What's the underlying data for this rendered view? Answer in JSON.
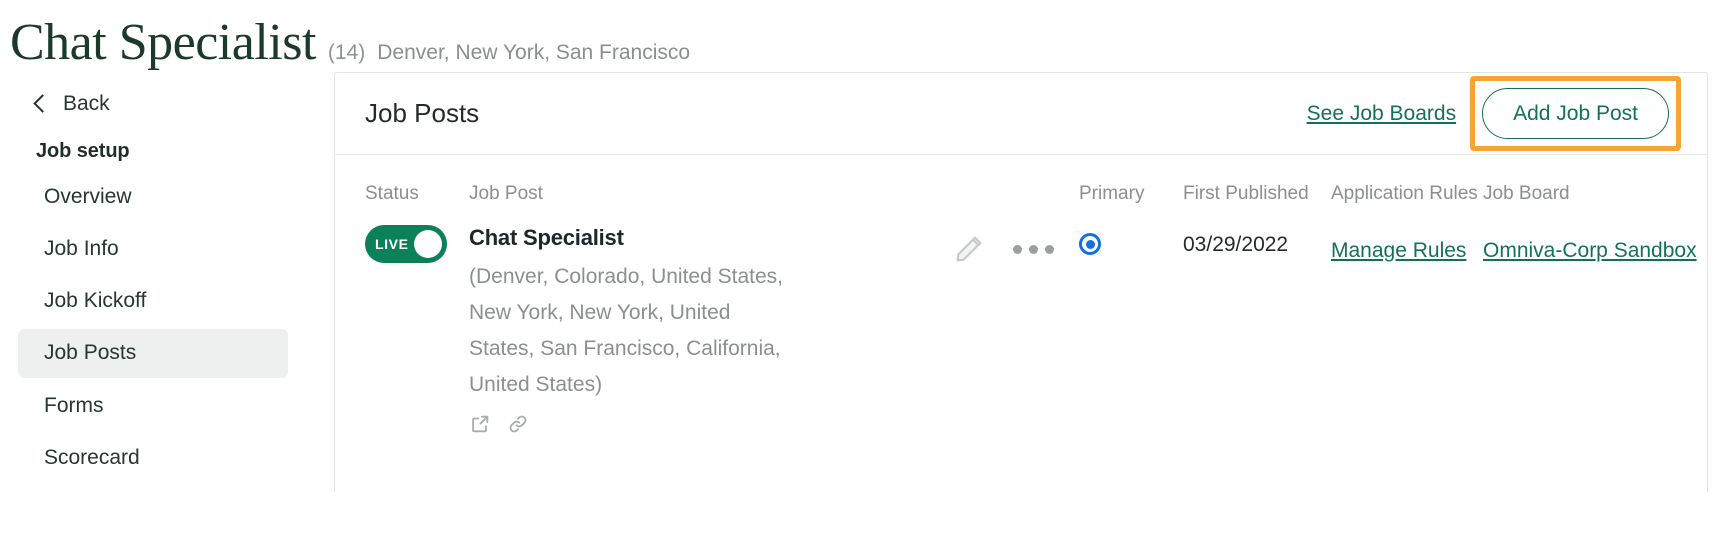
{
  "header": {
    "title": "Chat Specialist",
    "count": "(14)",
    "locations": "Denver, New York, San Francisco"
  },
  "sidebar": {
    "back_label": "Back",
    "group_title": "Job setup",
    "items": [
      {
        "label": "Overview",
        "active": false
      },
      {
        "label": "Job Info",
        "active": false
      },
      {
        "label": "Job Kickoff",
        "active": false
      },
      {
        "label": "Job Posts",
        "active": true
      },
      {
        "label": "Forms",
        "active": false
      },
      {
        "label": "Scorecard",
        "active": false
      }
    ]
  },
  "card": {
    "title": "Job Posts",
    "see_job_boards_label": "See Job Boards",
    "add_job_post_label": "Add Job Post",
    "highlight_color": "#f9a431",
    "accent_color": "#137350"
  },
  "table": {
    "columns": [
      "Status",
      "Job Post",
      "Primary",
      "First Published",
      "Application Rules",
      "Job Board"
    ],
    "rows": [
      {
        "status_label": "LIVE",
        "status_color": "#0a8159",
        "job_post_title": "Chat Specialist",
        "job_post_locations": "(Denver, Colorado, United States, New York, New York, United States, San Francisco, California, United States)",
        "row_icons": [
          "external-link-icon",
          "link-icon"
        ],
        "edit_icon": "pencil-icon",
        "more_icon": "ellipsis-icon",
        "primary_selected": true,
        "primary_color": "#1470e0",
        "first_published": "03/29/2022",
        "application_rules_label": "Manage Rules",
        "job_board_label": "Omniva-Corp Sandbox"
      }
    ]
  }
}
